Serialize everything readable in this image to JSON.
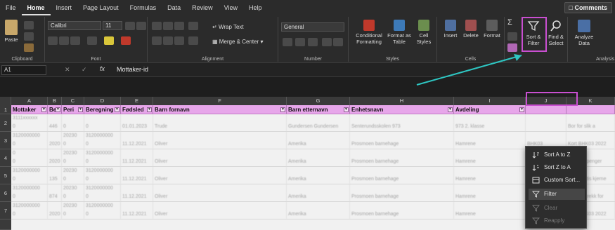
{
  "menubar": {
    "items": [
      "File",
      "Home",
      "Insert",
      "Page Layout",
      "Formulas",
      "Data",
      "Review",
      "View",
      "Help"
    ],
    "active": "Home",
    "comments_label": "Comments"
  },
  "ribbon": {
    "clipboard": {
      "paste": "Paste",
      "group": "Clipboard"
    },
    "font": {
      "name": "Calibri",
      "size": "11",
      "group": "Font"
    },
    "alignment": {
      "wrap": "Wrap Text",
      "merge": "Merge & Center",
      "group": "Alignment"
    },
    "number": {
      "format": "General",
      "group": "Number"
    },
    "styles": {
      "conditional": "Conditional Formatting",
      "format_table": "Format as Table",
      "cell_styles": "Cell Styles",
      "group": "Styles"
    },
    "cells": {
      "insert": "Insert",
      "delete": "Delete",
      "format": "Format",
      "group": "Cells"
    },
    "editing": {
      "sort_filter": "Sort & Filter",
      "find_select": "Find & Select"
    },
    "analyze": {
      "label": "Analyze Data",
      "group": "Analysis"
    }
  },
  "formula_bar": {
    "name_box": "A1",
    "fx": "fx",
    "formula": "Mottaker-id"
  },
  "grid": {
    "columns": [
      "A",
      "B",
      "C",
      "D",
      "E",
      "F",
      "G",
      "H",
      "I",
      "J",
      "K"
    ],
    "rows": [
      "1",
      "2",
      "3",
      "4",
      "5",
      "6",
      "7"
    ],
    "headers": [
      "Mottaker",
      "Be",
      "Peri",
      "Beregning",
      "Fødsled",
      "Barn fornavn",
      "Barn etternavn",
      "Enhetsnavn",
      "Avdeling",
      "",
      ""
    ],
    "data": [
      [
        "3111xxxxxx",
        "",
        "",
        "",
        "",
        "",
        "",
        "",
        "",
        "",
        ""
      ],
      [
        "0",
        "446",
        "0",
        "0",
        "01.01.2023",
        "Trude",
        "Gundersen Gundersen",
        "Senterundsskolen 973",
        "973 2. klasse",
        "",
        "Bor for slik a"
      ],
      [
        "3120000000",
        "",
        "20230",
        "3120000000",
        "",
        "",
        "",
        "",
        "",
        "",
        ""
      ],
      [
        "0",
        "2020",
        "0",
        "0",
        "11.12.2021",
        "Oliver",
        "Amerika",
        "Prosmoen barnehage",
        "Hamrene",
        "BHK03",
        "Kort BHK03 2022"
      ],
      [
        "0",
        "",
        "20230",
        "3120000000",
        "",
        "",
        "",
        "",
        "",
        "",
        ""
      ],
      [
        "0",
        "2020",
        "0",
        "0",
        "11.12.2021",
        "Oliver",
        "Amerika",
        "Prosmoen barnehage",
        "Hamrene",
        "BHK03",
        "Kort Matpenger"
      ],
      [
        "3120000000",
        "",
        "20230",
        "3120000000",
        "",
        "",
        "",
        "",
        "",
        "",
        ""
      ],
      [
        "0",
        "135",
        "0",
        "0",
        "11.12.2021",
        "Oliver",
        "Amerika",
        "Prosmoen barnehage",
        "Hamrene",
        "BHK03",
        "Kort Gratis kjerne"
      ],
      [
        "3120000000",
        "",
        "20230",
        "3120000000",
        "",
        "",
        "",
        "",
        "",
        "",
        ""
      ],
      [
        "0",
        "874",
        "0",
        "0",
        "11.12.2021",
        "Oliver",
        "Amerika",
        "Prosmoen barnehage",
        "Hamrene",
        "BHK03",
        "Kort Fratrekk for"
      ],
      [
        "3120000000",
        "",
        "20230",
        "3120000000",
        "",
        "",
        "",
        "",
        "",
        "",
        ""
      ],
      [
        "0",
        "2020",
        "0",
        "0",
        "11.12.2021",
        "Oliver",
        "Amerika",
        "Prosmoen barnehage",
        "Hamrene",
        "BHK03",
        "Kort BHK03 2022"
      ],
      [
        "3120000000",
        "",
        "20230",
        "3120000000",
        "",
        "",
        "",
        "",
        "",
        "",
        ""
      ]
    ]
  },
  "sort_menu": {
    "items": [
      "Sort A to Z",
      "Sort Z to A",
      "Custom Sort...",
      "Filter",
      "Clear",
      "Reapply"
    ]
  },
  "colors": {
    "highlight": "#c94fd1",
    "arrow": "#2ec7c3",
    "header_fill": "#e7a6ea"
  }
}
